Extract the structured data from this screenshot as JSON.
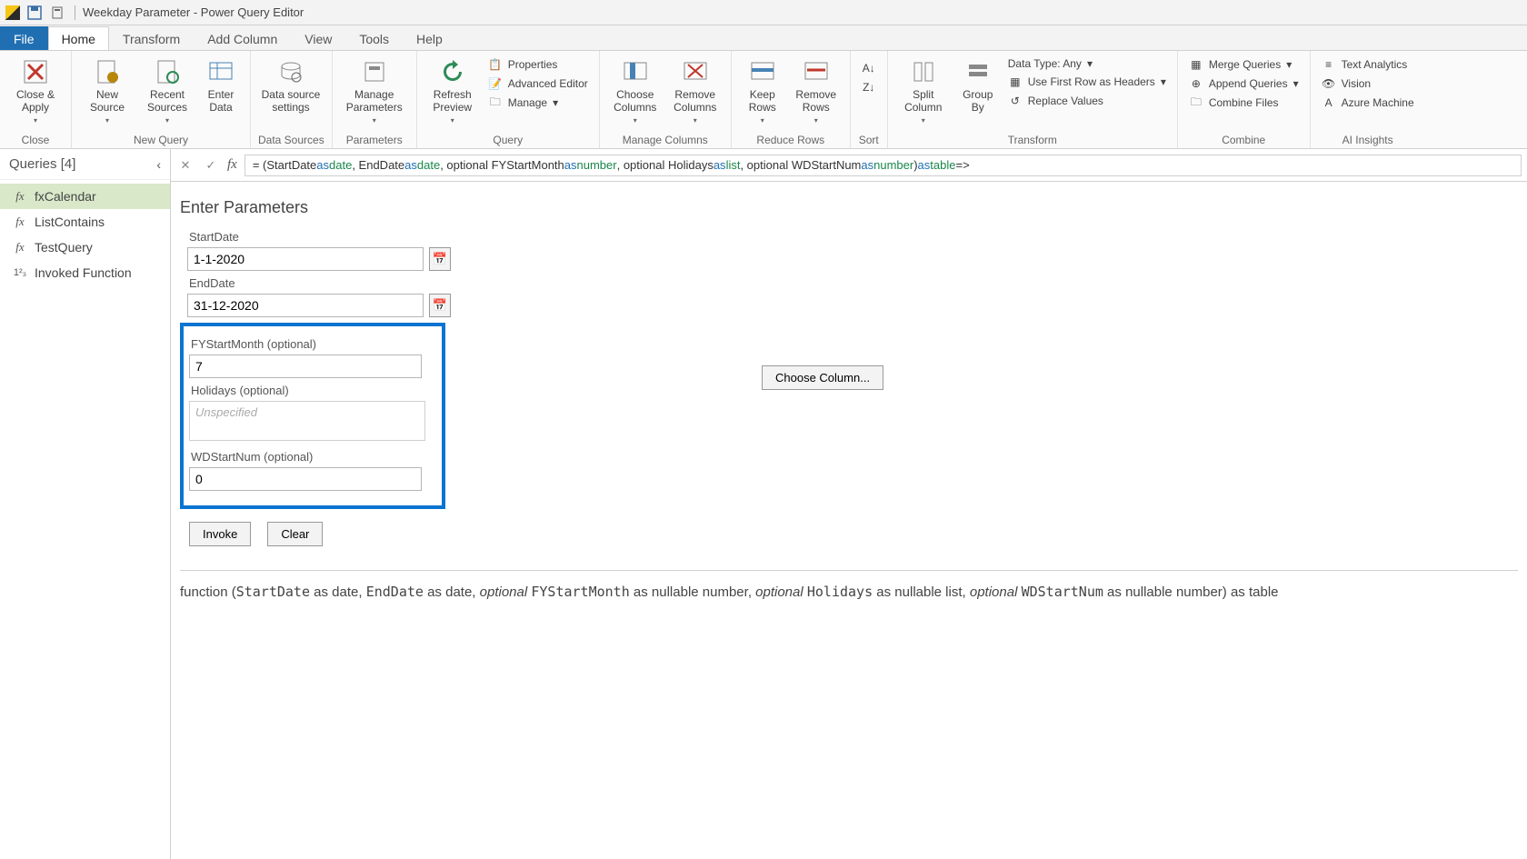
{
  "window": {
    "title": "Weekday Parameter - Power Query Editor"
  },
  "tabs": {
    "file": "File",
    "home": "Home",
    "transform": "Transform",
    "addcol": "Add Column",
    "view": "View",
    "tools": "Tools",
    "help": "Help"
  },
  "ribbon": {
    "close": {
      "closeapply": "Close &\nApply",
      "group": "Close"
    },
    "newquery": {
      "newsource": "New\nSource",
      "recent": "Recent\nSources",
      "enter": "Enter\nData",
      "group": "New Query"
    },
    "datasources": {
      "settings": "Data source\nsettings",
      "group": "Data Sources"
    },
    "parameters": {
      "manage": "Manage\nParameters",
      "group": "Parameters"
    },
    "query": {
      "refresh": "Refresh\nPreview",
      "properties": "Properties",
      "advanced": "Advanced Editor",
      "manage": "Manage",
      "group": "Query"
    },
    "managecols": {
      "choose": "Choose\nColumns",
      "remove": "Remove\nColumns",
      "group": "Manage Columns"
    },
    "reducerows": {
      "keep": "Keep\nRows",
      "remove": "Remove\nRows",
      "group": "Reduce Rows"
    },
    "sort": {
      "group": "Sort"
    },
    "transform": {
      "split": "Split\nColumn",
      "groupby": "Group\nBy",
      "datatype": "Data Type: Any",
      "firstrow": "Use First Row as Headers",
      "replace": "Replace Values",
      "group": "Transform"
    },
    "combine": {
      "merge": "Merge Queries",
      "append": "Append Queries",
      "files": "Combine Files",
      "group": "Combine"
    },
    "ai": {
      "text": "Text Analytics",
      "vision": "Vision",
      "azure": "Azure Machine",
      "group": "AI Insights"
    }
  },
  "queries": {
    "header": "Queries [4]",
    "items": [
      {
        "icon": "fx",
        "label": "fxCalendar"
      },
      {
        "icon": "fx",
        "label": "ListContains"
      },
      {
        "icon": "fx",
        "label": "TestQuery"
      },
      {
        "icon": "1²₃",
        "label": "Invoked Function"
      }
    ]
  },
  "formula": {
    "prefix": "= (StartDate ",
    "p1_as": "as ",
    "p1_type": "date",
    "c1": ", EndDate ",
    "p2_as": "as ",
    "p2_type": "date",
    "c2": ", optional FYStartMonth ",
    "p3_as": "as ",
    "p3_type": "number",
    "c3": ", optional Holidays ",
    "p4_as": "as ",
    "p4_type": "list",
    "c4": ", optional WDStartNum ",
    "p5_as": "as ",
    "p5_type": "number",
    "c5": ") ",
    "ret_as": "as ",
    "ret_type": "table",
    "arrow": " =>"
  },
  "params": {
    "title": "Enter Parameters",
    "startdate": {
      "label": "StartDate",
      "value": "1-1-2020"
    },
    "enddate": {
      "label": "EndDate",
      "value": "31-12-2020"
    },
    "fystart": {
      "label": "FYStartMonth (optional)",
      "value": "7"
    },
    "holidays": {
      "label": "Holidays (optional)",
      "placeholder": "Unspecified"
    },
    "wdstart": {
      "label": "WDStartNum (optional)",
      "value": "0"
    },
    "choosecol": "Choose Column...",
    "invoke": "Invoke",
    "clear": "Clear"
  },
  "signature": {
    "pre": "function (",
    "sd": "StartDate",
    "sd_t": " as date, ",
    "ed": "EndDate",
    "ed_t": " as date, ",
    "opt1": "optional ",
    "fy": "FYStartMonth",
    "fy_t": " as nullable number, ",
    "opt2": "optional ",
    "hol": "Holidays",
    "hol_t": " as nullable list, ",
    "opt3": "optional ",
    "wd": "WDStartNum",
    "wd_t": " as nullable number) as table"
  }
}
